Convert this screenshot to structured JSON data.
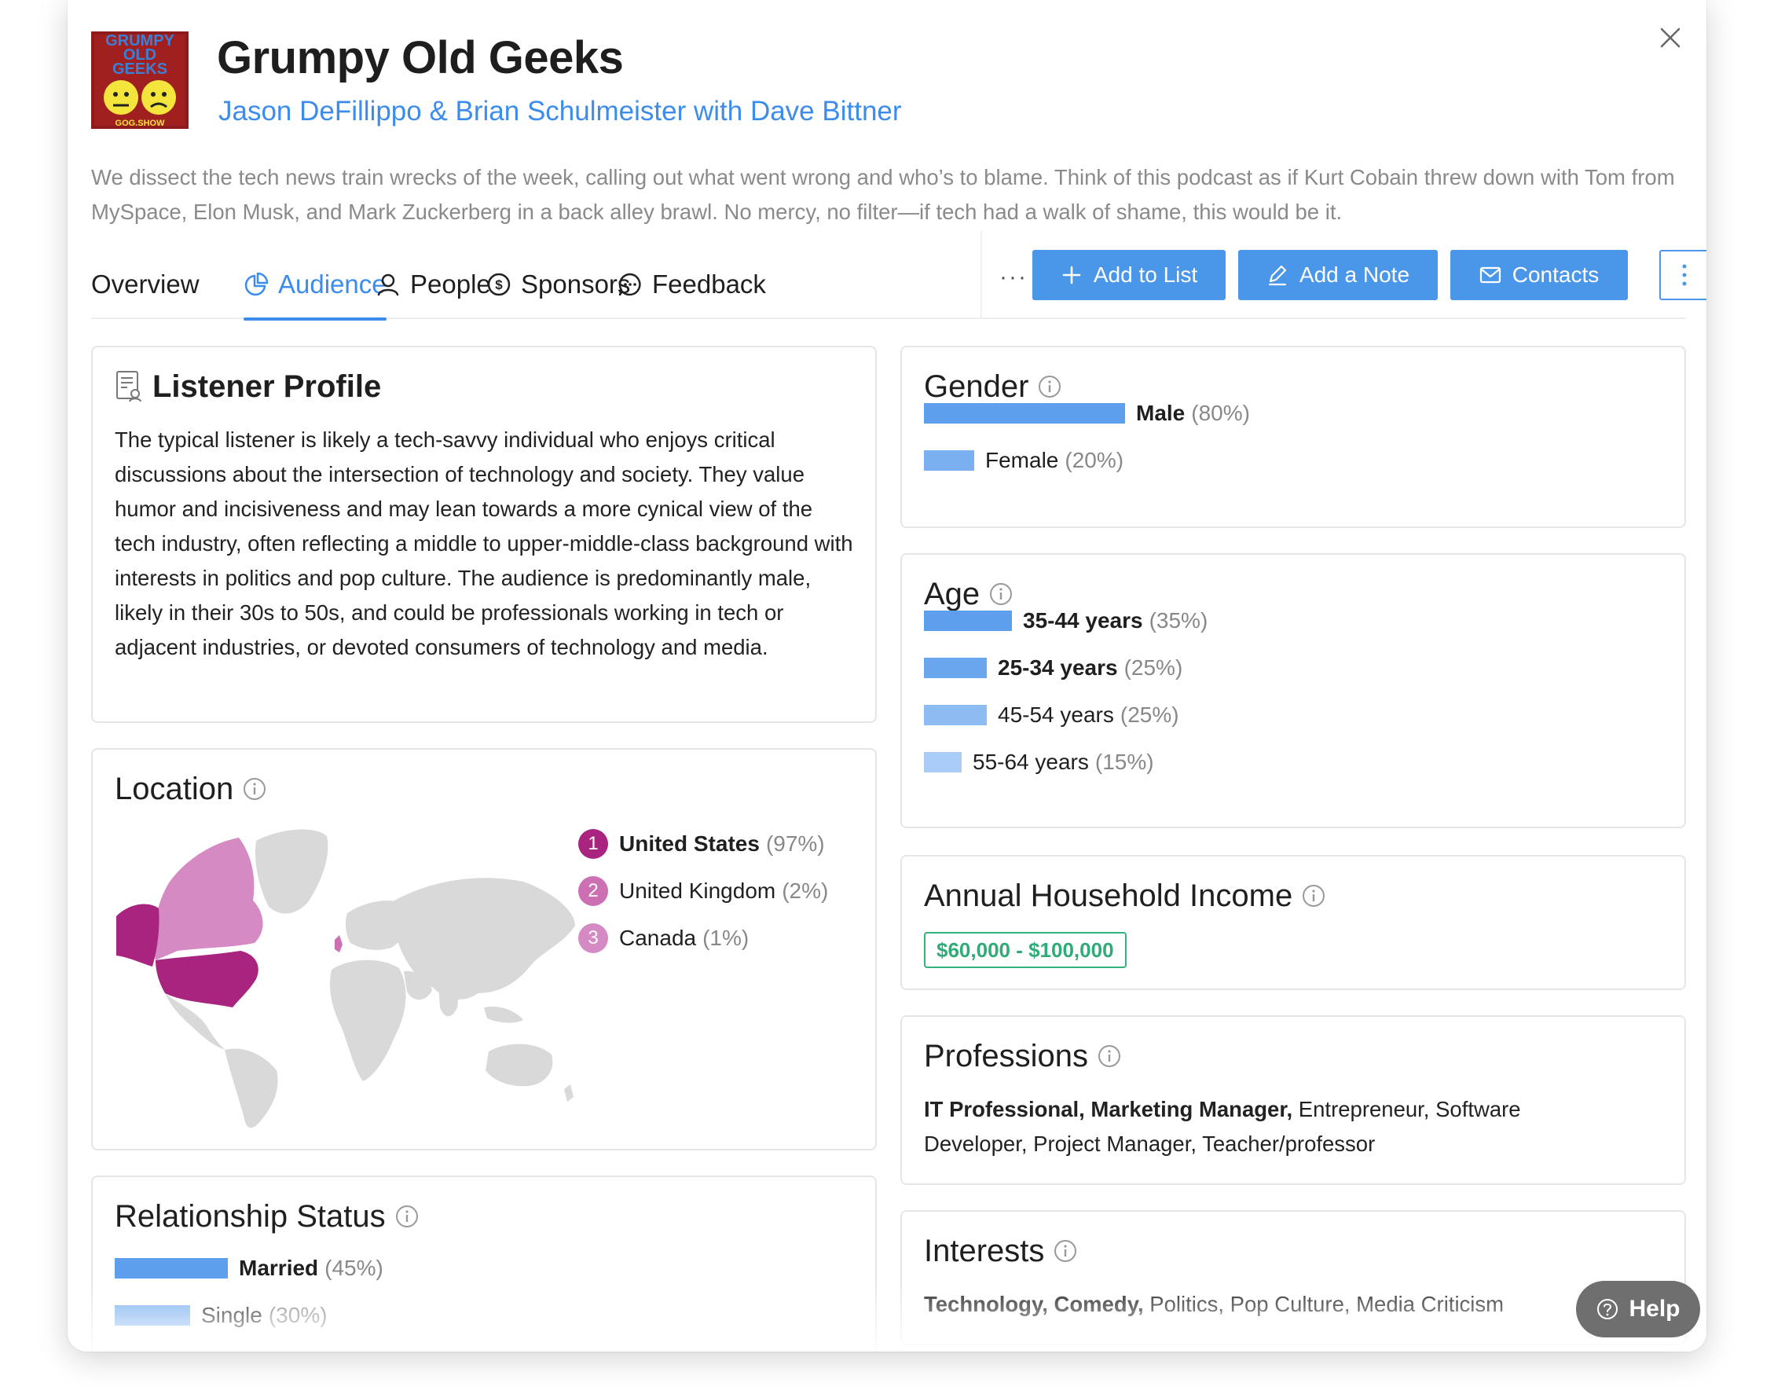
{
  "podcast": {
    "title": "Grumpy Old Geeks",
    "hosts": "Jason DeFillippo & Brian Schulmeister with Dave Bittner",
    "cover_text_1": "GRUMPY",
    "cover_text_2": "OLD",
    "cover_text_3": "GEEKS",
    "cover_text_4": "GOG.SHOW",
    "description": "We dissect the tech news train wrecks of the week, calling out what went wrong and who’s to blame. Think of this podcast as if Kurt Cobain threw down with Tom from MySpace, Elon Musk, and Mark Zuckerberg in a back alley brawl. No mercy, no filter—if tech had a walk of shame, this would be it."
  },
  "tabs": {
    "overview": "Overview",
    "audience": "Audience",
    "people": "People",
    "sponsors": "Sponsors",
    "feedback": "Feedback",
    "more": "···",
    "active": "audience"
  },
  "actions": {
    "add_to_list": "Add to List",
    "add_note": "Add a Note",
    "contacts": "Contacts"
  },
  "listener_profile": {
    "title": "Listener Profile",
    "text": "The typical listener is likely a tech-savvy individual who enjoys critical discussions about the intersection of technology and society. They value humor and incisiveness and may lean towards a more cynical view of the tech industry, often reflecting a middle to upper-middle-class background with interests in politics and pop culture. The audience is predominantly male, likely in their 30s to 50s, and could be professionals working in tech or adjacent industries, or devoted consumers of technology and media."
  },
  "location": {
    "title": "Location",
    "items": [
      {
        "rank": "1",
        "name": "United States",
        "pct": "(97%)",
        "color": "#a8247f"
      },
      {
        "rank": "2",
        "name": "United Kingdom",
        "pct": "(2%)",
        "color": "#cc6fb3"
      },
      {
        "rank": "3",
        "name": "Canada",
        "pct": "(1%)",
        "color": "#d68ac4"
      }
    ]
  },
  "relationship": {
    "title": "Relationship Status",
    "items": [
      {
        "label": "Married",
        "pct": "(45%)",
        "value": 45
      },
      {
        "label": "Single",
        "pct": "(30%)",
        "value": 30
      }
    ]
  },
  "gender": {
    "title": "Gender",
    "items": [
      {
        "label": "Male",
        "pct": "(80%)",
        "value": 80
      },
      {
        "label": "Female",
        "pct": "(20%)",
        "value": 20
      }
    ]
  },
  "age": {
    "title": "Age",
    "items": [
      {
        "label": "35-44 years",
        "pct": "(35%)",
        "value": 35
      },
      {
        "label": "25-34 years",
        "pct": "(25%)",
        "value": 25
      },
      {
        "label": "45-54 years",
        "pct": "(25%)",
        "value": 25
      },
      {
        "label": "55-64 years",
        "pct": "(15%)",
        "value": 15
      }
    ]
  },
  "income": {
    "title": "Annual Household Income",
    "range": "$60,000 - $100,000"
  },
  "professions": {
    "title": "Professions",
    "bold": "IT Professional, Marketing Manager,",
    "rest": " Entrepreneur, Software Developer, Project Manager, Teacher/professor"
  },
  "interests": {
    "title": "Interests",
    "bold": "Technology, Comedy,",
    "rest": " Politics, Pop Culture, Media Criticism"
  },
  "help": {
    "label": "Help"
  },
  "colors": {
    "accent": "#3b8ced",
    "button": "#4a97ea",
    "bar_strong": "#5d9eed",
    "bar_light": "#8fbdf3",
    "income": "#2fab77",
    "map_grey": "#d9d9d9"
  }
}
